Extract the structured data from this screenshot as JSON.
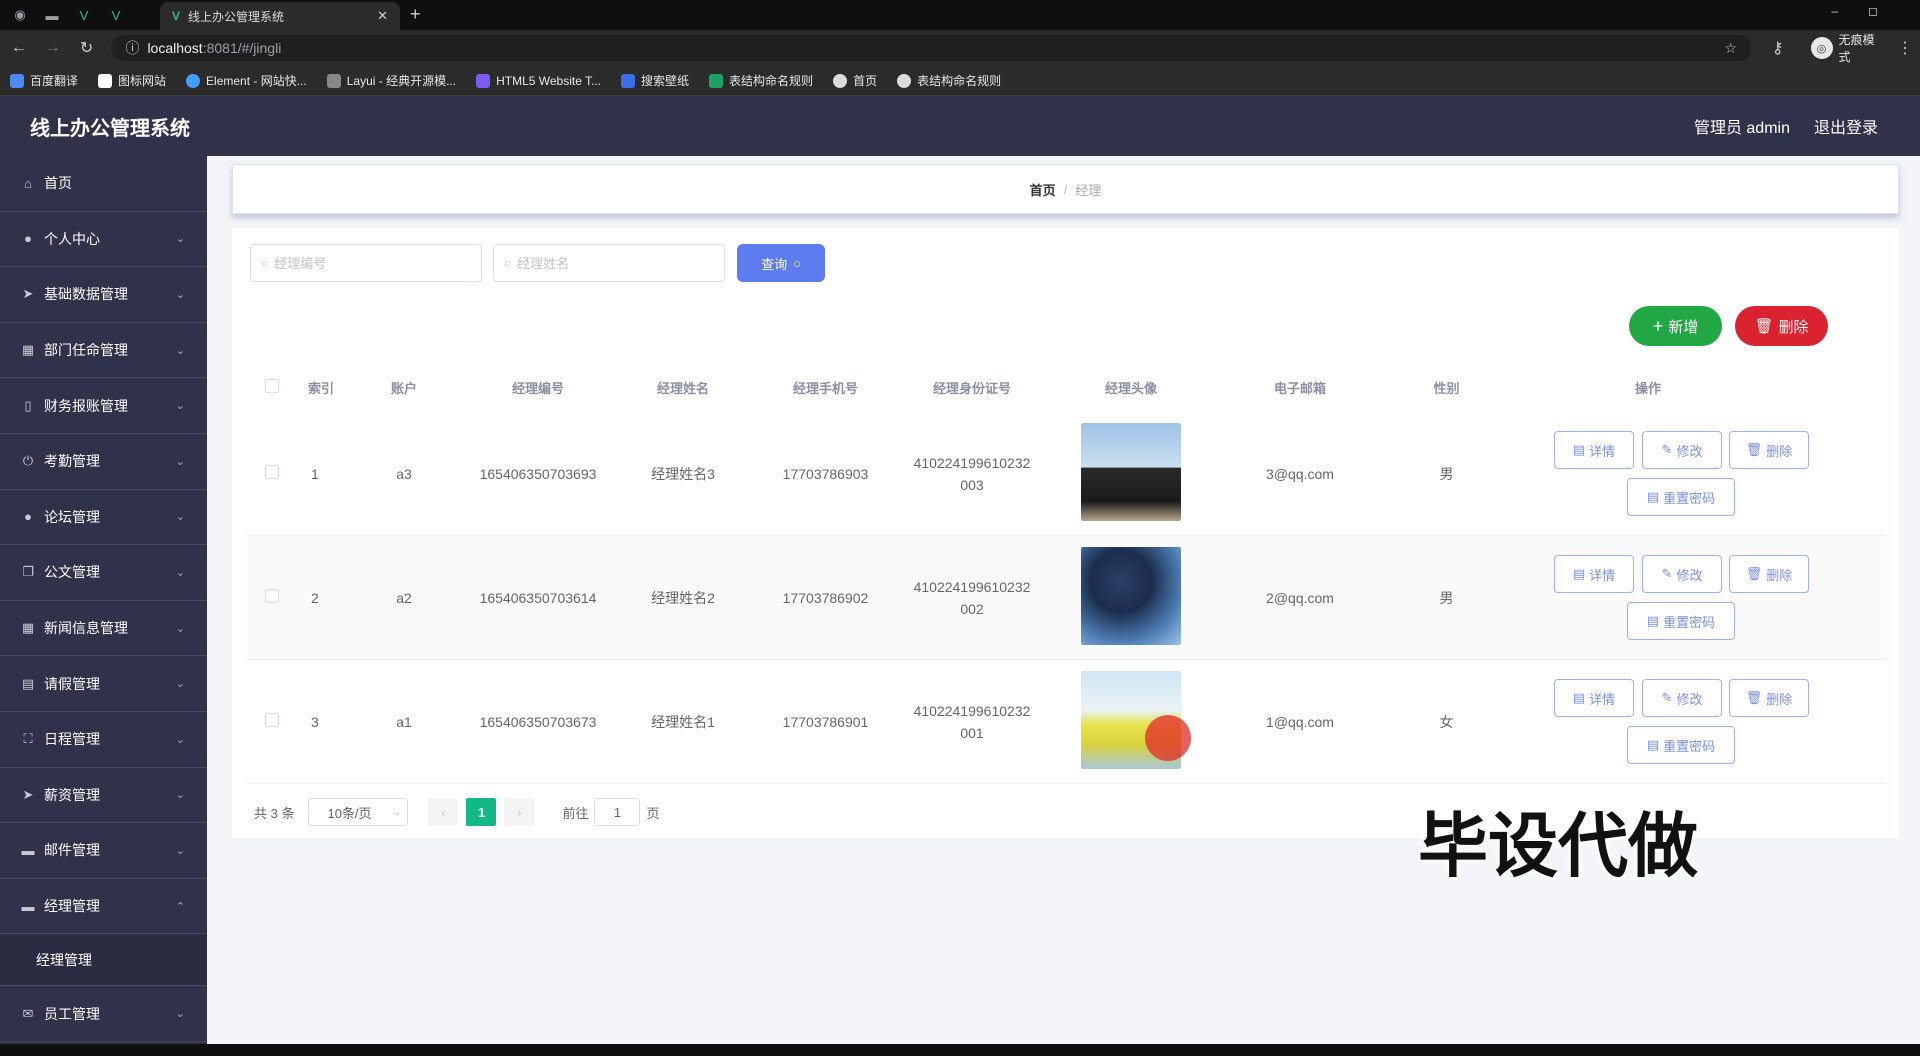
{
  "browser": {
    "tab_title": "线上办公管理系统",
    "url_host": "localhost",
    "url_path": ":8081/#/jingli",
    "profile_label": "无痕模式",
    "bookmarks": [
      "百度翻译",
      "图标网站",
      "Element - 网站快...",
      "Layui - 经典开源模...",
      "HTML5 Website T...",
      "搜索壁纸",
      "表结构命名规则",
      "首页",
      "表结构命名规则"
    ]
  },
  "header": {
    "title": "线上办公管理系统",
    "user": "管理员 admin",
    "logout": "退出登录"
  },
  "sidebar": {
    "items": [
      {
        "label": "首页",
        "icon": "home-icon"
      },
      {
        "label": "个人中心",
        "icon": "user-icon"
      },
      {
        "label": "基础数据管理",
        "icon": "send-icon"
      },
      {
        "label": "部门任命管理",
        "icon": "chart-icon"
      },
      {
        "label": "财务报账管理",
        "icon": "phone-icon"
      },
      {
        "label": "考勤管理",
        "icon": "power-icon"
      },
      {
        "label": "论坛管理",
        "icon": "user-icon"
      },
      {
        "label": "公文管理",
        "icon": "copy-icon"
      },
      {
        "label": "新闻信息管理",
        "icon": "grid-icon"
      },
      {
        "label": "请假管理",
        "icon": "clipboard-icon"
      },
      {
        "label": "日程管理",
        "icon": "frame-icon"
      },
      {
        "label": "薪资管理",
        "icon": "send-icon"
      },
      {
        "label": "邮件管理",
        "icon": "monitor-icon"
      },
      {
        "label": "经理管理",
        "icon": "chat-icon"
      }
    ],
    "sub_item": "经理管理",
    "last_item": {
      "label": "员工管理",
      "icon": "mail-icon"
    }
  },
  "breadcrumb": {
    "home": "首页",
    "current": "经理"
  },
  "search": {
    "placeholder_no": "经理编号",
    "placeholder_name": "经理姓名",
    "query_label": "查询"
  },
  "actions": {
    "add_label": "新增",
    "delete_label": "删除"
  },
  "table": {
    "headers": [
      "索引",
      "账户",
      "经理编号",
      "经理姓名",
      "经理手机号",
      "经理身份证号",
      "经理头像",
      "电子邮箱",
      "性别",
      "操作"
    ],
    "rows": [
      {
        "index": "1",
        "account": "a3",
        "no": "165406350703693",
        "name": "经理姓名3",
        "phone": "17703786903",
        "id1": "410224199610232",
        "id2": "003",
        "email": "3@qq.com",
        "gender": "男"
      },
      {
        "index": "2",
        "account": "a2",
        "no": "165406350703614",
        "name": "经理姓名2",
        "phone": "17703786902",
        "id1": "410224199610232",
        "id2": "002",
        "email": "2@qq.com",
        "gender": "男"
      },
      {
        "index": "3",
        "account": "a1",
        "no": "165406350703673",
        "name": "经理姓名1",
        "phone": "17703786901",
        "id1": "410224199610232",
        "id2": "001",
        "email": "1@qq.com",
        "gender": "女"
      }
    ],
    "row_buttons": {
      "detail": "详情",
      "edit": "修改",
      "delete": "删除",
      "reset": "重置密码"
    }
  },
  "pagination": {
    "total": "共 3 条",
    "page_size": "10条/页",
    "current": "1",
    "goto_prefix": "前往",
    "goto_value": "1",
    "goto_suffix": "页"
  },
  "watermark": "毕设代做",
  "colors": {
    "sidebar": "#30324a",
    "primary": "#5c7cf0",
    "success": "#22a745",
    "danger": "#d9232e",
    "page_active": "#12b886"
  }
}
